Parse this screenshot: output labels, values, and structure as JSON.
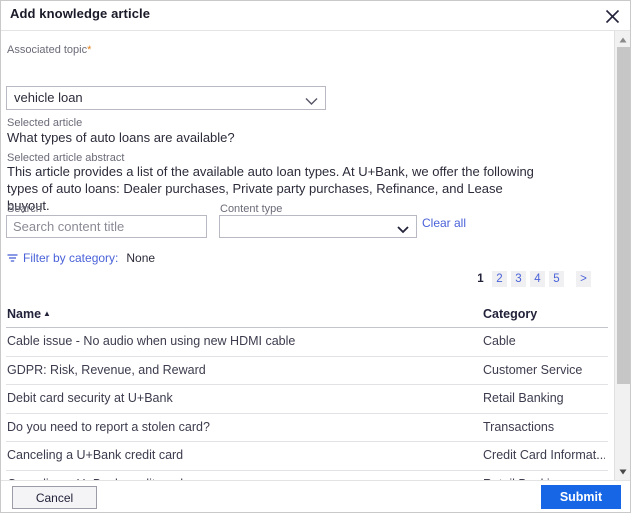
{
  "modal": {
    "title": "Add knowledge article",
    "close_icon": "close-icon"
  },
  "form": {
    "associated_topic": {
      "label": "Associated topic",
      "required_marker": "*",
      "value": "vehicle loan",
      "chevron_icon": "chevron-down-icon"
    },
    "selected_article": {
      "label": "Selected article",
      "value": "What types of auto loans are available?"
    },
    "selected_article_abstract": {
      "label": "Selected article abstract",
      "value": "This article provides a list of the available auto loan types. At U+Bank, we offer the following types of auto loans: Dealer purchases, Private party purchases, Refinance, and Lease buyout."
    }
  },
  "filters": {
    "search": {
      "label": "Search",
      "value": "",
      "placeholder": "Search content title"
    },
    "content_type": {
      "label": "Content type",
      "value": "",
      "chevron_icon": "chevron-down-icon"
    },
    "clear_all_label": "Clear all",
    "filter_by_category": {
      "icon": "filter-icon",
      "label": "Filter by category:",
      "value": "None"
    }
  },
  "pagination": {
    "pages": [
      "1",
      "2",
      "3",
      "4",
      "5"
    ],
    "current": "1",
    "next_label": ">"
  },
  "table": {
    "columns": [
      {
        "label": "Name",
        "sort": "▲"
      },
      {
        "label": "Category",
        "sort": ""
      }
    ],
    "rows": [
      {
        "name": "Cable issue - No audio when using new HDMI cable",
        "category": "Cable"
      },
      {
        "name": "GDPR: Risk, Revenue, and Reward",
        "category": "Customer Service"
      },
      {
        "name": "Debit card security at U+Bank",
        "category": "Retail Banking"
      },
      {
        "name": "Do you need to report a stolen card?",
        "category": "Transactions"
      },
      {
        "name": "Canceling a U+Bank credit card",
        "category": "Credit Card Informat..."
      },
      {
        "name": "Canceling a U+Bank credit card",
        "category": "Retail Banking"
      }
    ]
  },
  "footer": {
    "cancel_label": "Cancel",
    "submit_label": "Submit"
  },
  "colors": {
    "accent_blue": "#1766e6",
    "link_blue": "#4a62d8",
    "required_orange": "#e4801d",
    "text_dark": "#22223a",
    "label_gray": "#6b6b78"
  }
}
